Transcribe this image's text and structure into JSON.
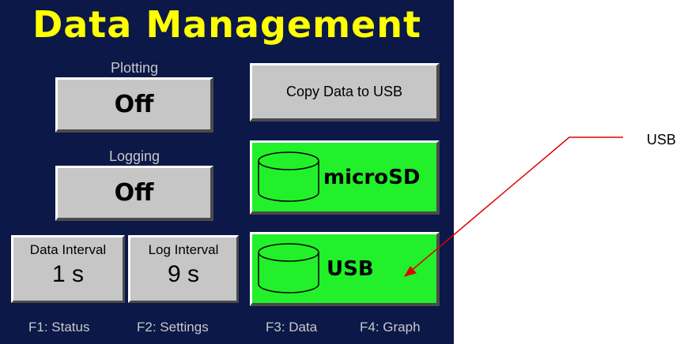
{
  "title": "Data Management",
  "plotting": {
    "label": "Plotting",
    "value": "Off"
  },
  "logging": {
    "label": "Logging",
    "value": "Off"
  },
  "copy_button": "Copy Data to USB",
  "drives": {
    "microsd": "microSD",
    "usb": "USB"
  },
  "data_interval": {
    "label": "Data Interval",
    "value": "1 s"
  },
  "log_interval": {
    "label": "Log Interval",
    "value": "9 s"
  },
  "function_keys": [
    "F1: Status",
    "F2: Settings",
    "F3: Data",
    "F4: Graph"
  ],
  "annotation": {
    "text": "USB",
    "color": "#e00000"
  },
  "colors": {
    "background": "#0b1848",
    "title": "#ffff00",
    "active_green": "#22f02a",
    "button_gray": "#c6c6c6"
  }
}
